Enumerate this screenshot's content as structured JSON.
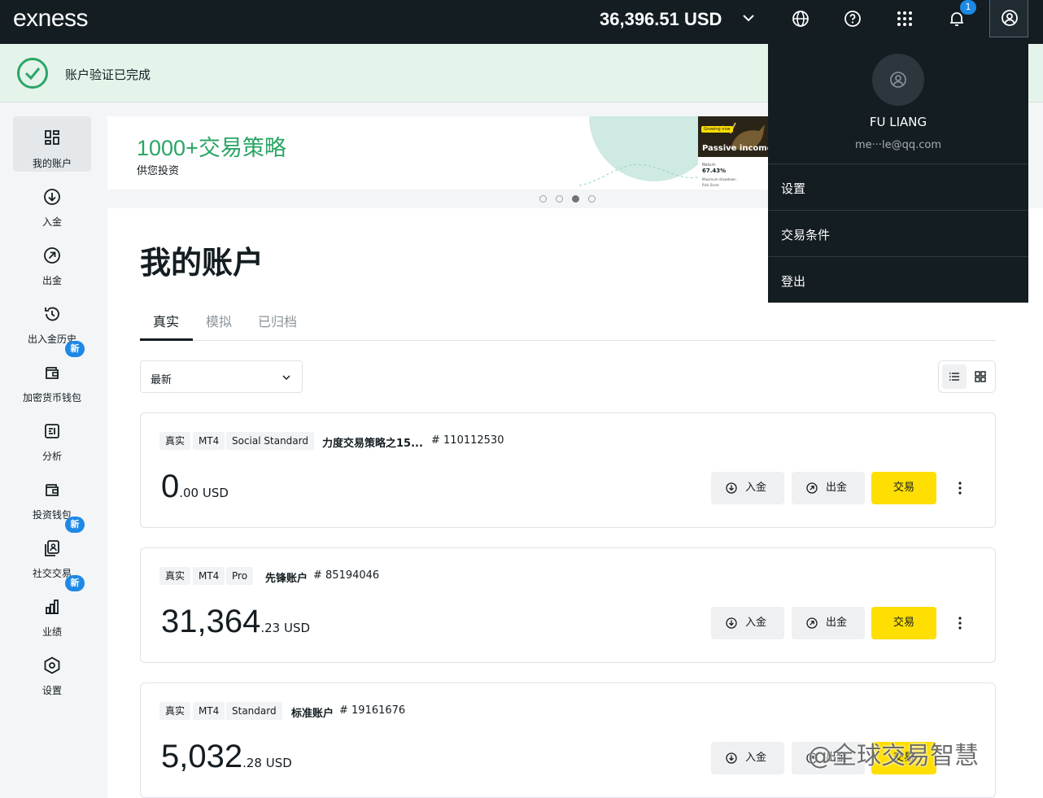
{
  "topbar": {
    "logo": "exness",
    "balance": "36,396.51 USD",
    "notification_count": "1"
  },
  "verification": {
    "text": "账户验证已完成"
  },
  "sidebar": {
    "items": [
      {
        "label": "我的账户",
        "icon": "accounts-grid-icon",
        "active": true
      },
      {
        "label": "入金",
        "icon": "deposit-icon"
      },
      {
        "label": "出金",
        "icon": "withdraw-icon"
      },
      {
        "label": "出入金历史",
        "icon": "history-icon"
      },
      {
        "label": "加密货币钱包",
        "icon": "crypto-wallet-icon",
        "badge": "新"
      },
      {
        "label": "分析",
        "icon": "analytics-icon"
      },
      {
        "label": "投资钱包",
        "icon": "investment-wallet-icon"
      },
      {
        "label": "社交交易",
        "icon": "social-trading-icon",
        "badge": "新"
      },
      {
        "label": "业绩",
        "icon": "performance-icon",
        "badge": "新"
      },
      {
        "label": "设置",
        "icon": "settings-icon"
      }
    ]
  },
  "banner": {
    "title": "1000+交易策略",
    "subtitle": "供您投资",
    "card_tag": "Growing now",
    "card_title": "Passive income",
    "card_return_label": "Return",
    "card_return_value": "67.43%",
    "card_drawdown_label": "Maximum drawdown",
    "card_risk_label": "Risk Score",
    "slides": 4,
    "active_slide": 3
  },
  "main": {
    "title": "我的账户",
    "tabs": [
      "真实",
      "模拟",
      "已归档"
    ],
    "active_tab": "真实",
    "sort_value": "最新"
  },
  "accounts": [
    {
      "chips": [
        "真实",
        "MT4",
        "Social Standard"
      ],
      "name": "力度交易策略之15...",
      "number": "# 110112530",
      "amount_int": "0",
      "amount_dec": ".00 USD"
    },
    {
      "chips": [
        "真实",
        "MT4",
        "Pro"
      ],
      "name": "先锋账户",
      "number": "# 85194046",
      "amount_int": "31,364",
      "amount_dec": ".23 USD"
    },
    {
      "chips": [
        "真实",
        "MT4",
        "Standard"
      ],
      "name": "标准账户",
      "number": "# 19161676",
      "amount_int": "5,032",
      "amount_dec": ".28 USD"
    }
  ],
  "account_actions": {
    "deposit": "入金",
    "withdraw": "出金",
    "trade": "交易"
  },
  "profile_menu": {
    "name": "FU LIANG",
    "email": "me···le@qq.com",
    "items": [
      "设置",
      "交易条件",
      "登出"
    ]
  },
  "watermark": "@全球交易智慧",
  "colors": {
    "topbar": "#141d22",
    "accent_yellow": "#ffde02",
    "success_green": "#2aa566",
    "badge_blue": "#1e88e5"
  }
}
